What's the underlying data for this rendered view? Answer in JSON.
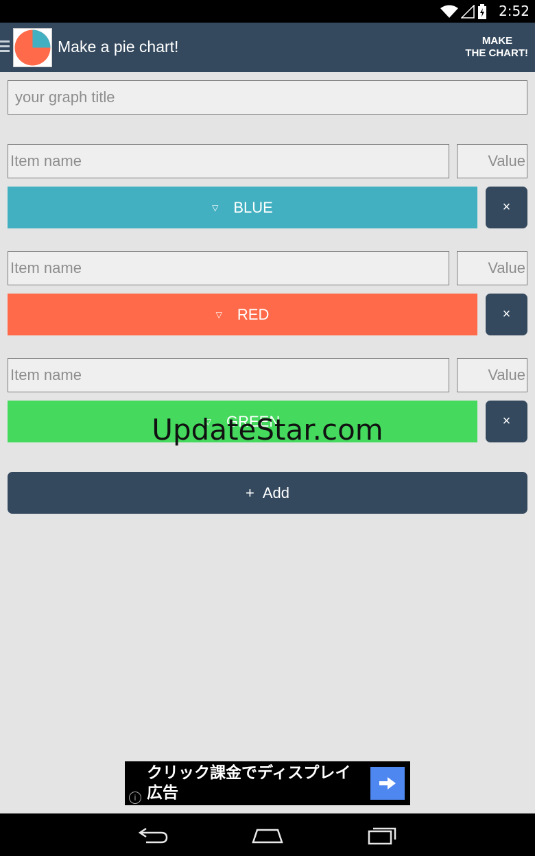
{
  "status_bar": {
    "time": "2:52",
    "icons": [
      "wifi-icon",
      "signal-icon",
      "battery-charging-icon"
    ]
  },
  "app_bar": {
    "title": "Make a pie chart!",
    "action_line1": "MAKE",
    "action_line2": "THE CHART!"
  },
  "form": {
    "title_placeholder": "your graph title",
    "items": [
      {
        "name_placeholder": "Item name",
        "value_placeholder": "Value",
        "color_label": "BLUE",
        "color_hex": "#42b0c0",
        "caret": "▽",
        "remove": "×"
      },
      {
        "name_placeholder": "Item name",
        "value_placeholder": "Value",
        "color_label": "RED",
        "color_hex": "#ff6b4a",
        "caret": "▽",
        "remove": "×"
      },
      {
        "name_placeholder": "Item name",
        "value_placeholder": "Value",
        "color_label": "GREEN",
        "color_hex": "#45d95e",
        "caret": "▽",
        "remove": "×"
      }
    ],
    "add_label": "Add",
    "add_symbol": "+"
  },
  "watermark": "UpdateStar.com",
  "ad": {
    "text_line1": "クリック課金でディスプレイ",
    "text_line2": "広告",
    "info": "i"
  },
  "colors": {
    "primary": "#34495e",
    "background": "#e4e4e4",
    "logo_teal": "#42b0c0",
    "logo_red": "#ff6b4a"
  }
}
